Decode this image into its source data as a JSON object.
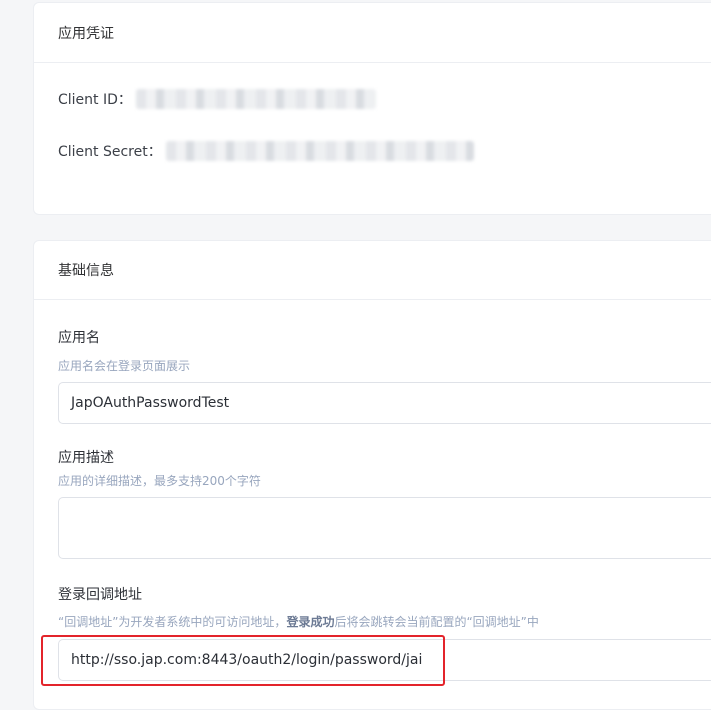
{
  "credentials": {
    "title": "应用凭证",
    "client_id_label": "Client ID：",
    "client_secret_label": "Client Secret："
  },
  "basic_info": {
    "title": "基础信息",
    "app_name": {
      "label": "应用名",
      "hint": "应用名会在登录页面展示",
      "value": "JapOAuthPasswordTest"
    },
    "app_description": {
      "label": "应用描述",
      "hint": "应用的详细描述，最多支持200个字符",
      "value": ""
    },
    "redirect_uri": {
      "label": "登录回调地址",
      "hint_prefix": "“回调地址”为开发者系统中的可访问地址，",
      "hint_bold": "登录成功",
      "hint_suffix": "后将会跳转会当前配置的“回调地址”中",
      "value": "http://sso.jap.com:8443/oauth2/login/password/jai"
    }
  },
  "colors": {
    "highlight_border": "#e3242b",
    "hint_text": "#98a6be"
  }
}
